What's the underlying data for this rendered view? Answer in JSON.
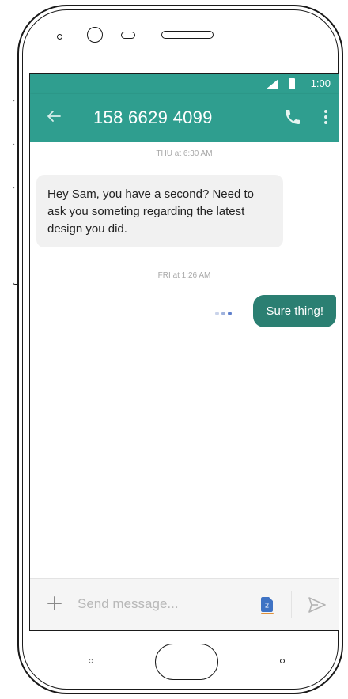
{
  "status_bar": {
    "time": "1:00"
  },
  "app_bar": {
    "title": "158 6629 4099"
  },
  "conversation": {
    "timestamp_1": "THU at 6:30 AM",
    "incoming_message": "Hey Sam, you have a second? Need to ask you someting regarding the latest design you did.",
    "timestamp_2": "FRI at 1:26 AM",
    "outgoing_message": "Sure thing!"
  },
  "composer": {
    "placeholder": "Send message...",
    "sim_badge": "2"
  },
  "icons": {
    "back": "arrow-left-icon",
    "call": "phone-icon",
    "more": "more-vert-icon",
    "add": "plus-icon",
    "sim": "sim-card-icon",
    "send": "send-icon"
  },
  "colors": {
    "accent": "#2f9e8f",
    "outgoing_bubble": "#2b7f72",
    "incoming_bubble": "#f1f1f1",
    "typing_dots": [
      "#c9d3ea",
      "#9fb2dd",
      "#5f80cc"
    ]
  }
}
